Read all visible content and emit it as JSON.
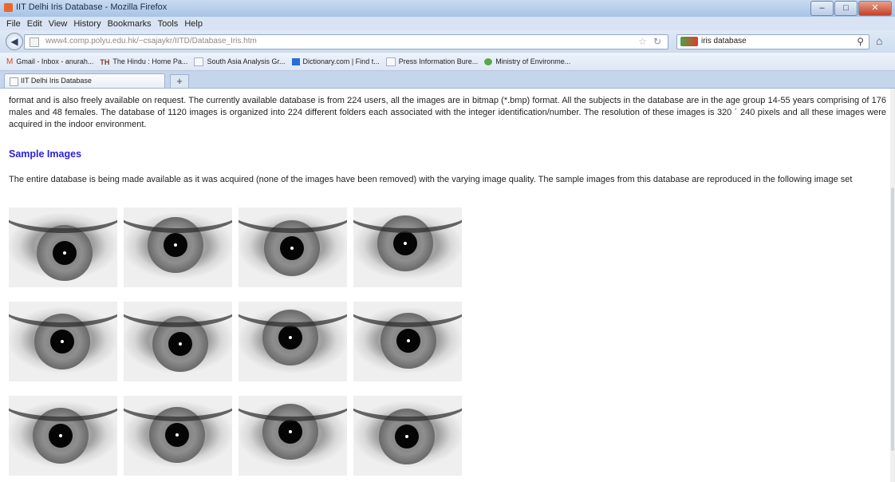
{
  "window": {
    "title": "IIT Delhi Iris Database - Mozilla Firefox",
    "controls": {
      "minimize": "–",
      "maximize": "□",
      "close": "✕"
    }
  },
  "menu": [
    "File",
    "Edit",
    "View",
    "History",
    "Bookmarks",
    "Tools",
    "Help"
  ],
  "nav": {
    "back_glyph": "◀",
    "url": "www4.comp.polyu.edu.hk/~csajaykr/IITD/Database_Iris.htm",
    "search_value": "iris database",
    "home_glyph": "⌂"
  },
  "bookmarks": [
    {
      "label": "Gmail - Inbox - anurah...",
      "icon": "gmail-icon"
    },
    {
      "label": "The Hindu : Home Pa...",
      "icon": "hindu-icon"
    },
    {
      "label": "South Asia Analysis Gr...",
      "icon": "page-icon"
    },
    {
      "label": "Dictionary.com | Find t...",
      "icon": "dictionary-icon"
    },
    {
      "label": "Press Information Bure...",
      "icon": "page-icon"
    },
    {
      "label": "Ministry of Environme...",
      "icon": "moef-icon"
    }
  ],
  "tab": {
    "label": "IIT Delhi Iris Database",
    "new_tab_glyph": "+"
  },
  "content": {
    "para1": "format and is also freely available on request. The currently available database is from 224 users, all the images are in bitmap (*.bmp) format. All the subjects in the database are in the age group 14-55 years comprising of 176 males and 48 females. The database of 1120 images is organized into 224 different folders each associated with the integer identification/number. The resolution of these images is 320 ´ 240 pixels and all these images were acquired in the indoor environment.",
    "heading": "Sample Images",
    "para2": "The entire database is being made available as it was acquired (none of the images have been removed) with the varying image quality. The sample images from this database are reproduced in the following image set"
  },
  "images": {
    "description_name": "iris-sample-image",
    "count": 12
  }
}
